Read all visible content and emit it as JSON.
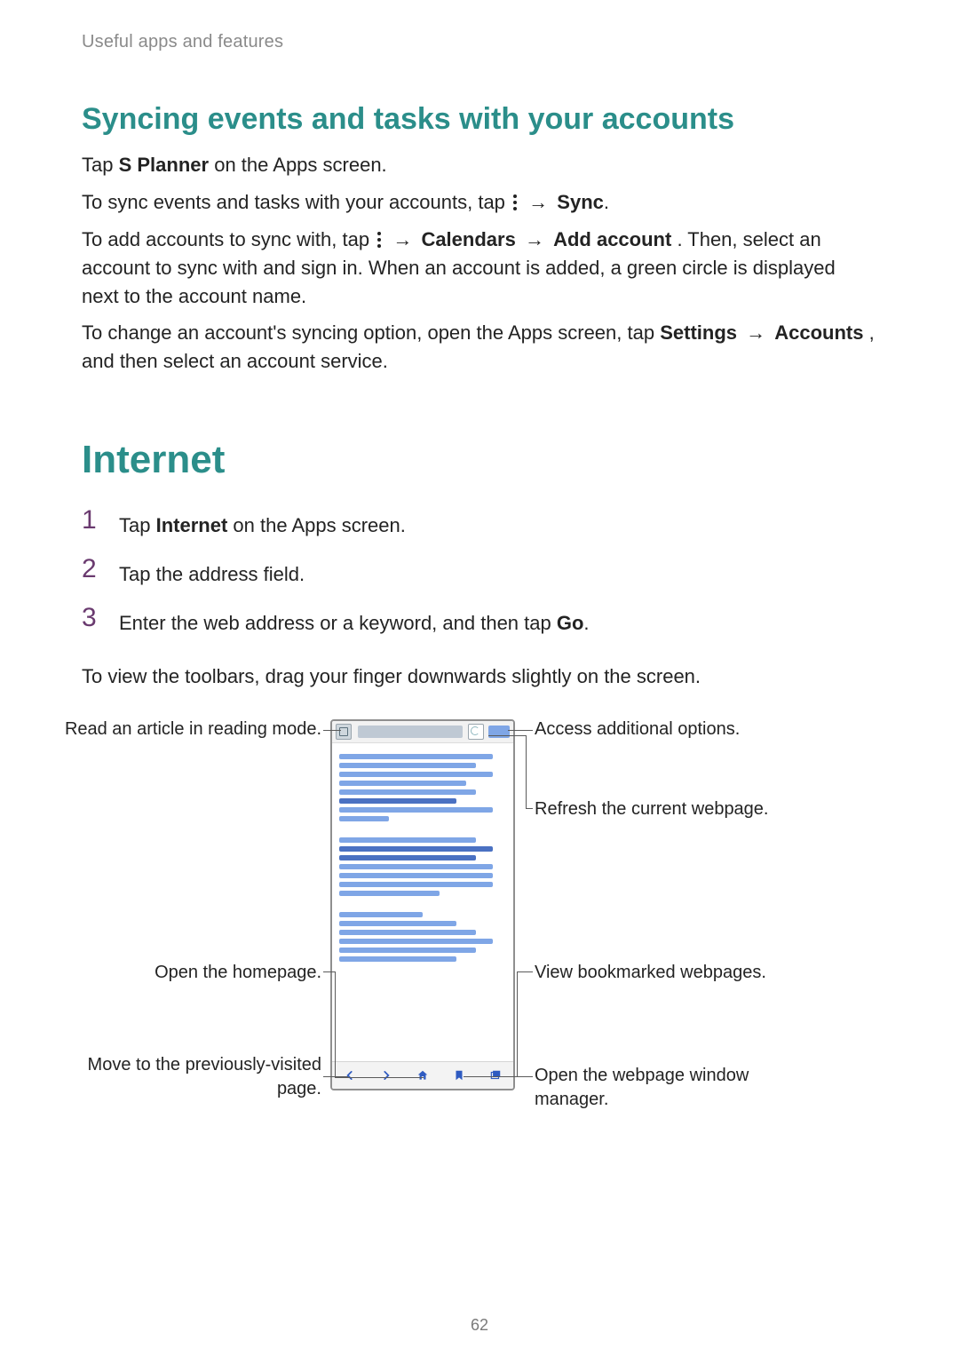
{
  "section_header": "Useful apps and features",
  "heading_sync": "Syncing events and tasks with your accounts",
  "sync": {
    "p1_pre": "Tap ",
    "p1_bold": "S Planner",
    "p1_post": " on the Apps screen.",
    "p2_pre": "To sync events and tasks with your accounts, tap ",
    "p2_arrow": "→",
    "p2_bold": "Sync",
    "p2_post": ".",
    "p3_pre": "To add accounts to sync with, tap ",
    "p3_arrow1": "→",
    "p3_b1": "Calendars",
    "p3_arrow2": "→",
    "p3_b2": "Add account",
    "p3_mid": ". Then, select an account to sync with and sign in. When an account is added, a green circle is displayed next to the account name.",
    "p4_pre": "To change an account's syncing option, open the Apps screen, tap ",
    "p4_b1": "Settings",
    "p4_arrow": "→",
    "p4_b2": "Accounts",
    "p4_post": ", and then select an account service."
  },
  "heading_internet": "Internet",
  "steps": [
    {
      "num": "1",
      "pre": "Tap ",
      "bold": "Internet",
      "post": " on the Apps screen."
    },
    {
      "num": "2",
      "pre": "",
      "bold": "",
      "post": "Tap the address field."
    },
    {
      "num": "3",
      "pre": "Enter the web address or a keyword, and then tap ",
      "bold": "Go",
      "post": "."
    }
  ],
  "toolbars_hint": "To view the toolbars, drag your finger downwards slightly on the screen.",
  "annotations": {
    "read_mode": "Read an article in reading mode.",
    "more": "Access additional options.",
    "refresh": "Refresh the current webpage.",
    "home": "Open the homepage.",
    "bookmarks": "View bookmarked webpages.",
    "back": "Move to the previously-visited page.",
    "windows": "Open the webpage window manager."
  },
  "page_number": "62"
}
